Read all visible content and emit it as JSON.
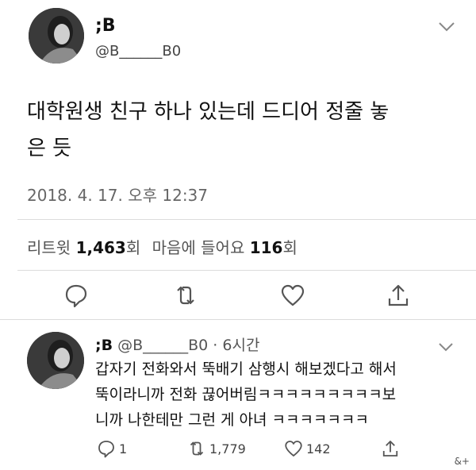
{
  "tweet": {
    "display_name": ";B",
    "handle": "@B______B0",
    "text_line1": "대학원생 친구 하나 있는데 드디어 정줄 놓",
    "text_line2": "은 듯",
    "timestamp": "2018. 4. 17. 오후 12:37",
    "retweets_label": "리트윗",
    "retweets_count": "1,463",
    "retweets_unit": "회",
    "likes_label": "마음에 들어요",
    "likes_count": "116",
    "likes_unit": "회"
  },
  "reply": {
    "display_name": ";B",
    "handle_time": "@B______B0 · 6시간",
    "text_line1": "갑자기 전화와서 뚝배기 삼행시 해보겠다고 해서",
    "text_line2": "뚝이라니까 전화 끊어버림ㅋㅋㅋㅋㅋㅋㅋㅋㅋ보",
    "text_line3": "니까 나한테만 그런 게 아녀 ㅋㅋㅋㅋㅋㅋㅋ",
    "reply_count": "1",
    "retweet_count": "1,779",
    "like_count": "142"
  },
  "watermark": "&+",
  "icons": {
    "reply": "speech-bubble-icon",
    "retweet": "retweet-arrows-icon",
    "like": "heart-icon",
    "share": "share-upload-icon",
    "menu": "chevron-down-icon"
  }
}
